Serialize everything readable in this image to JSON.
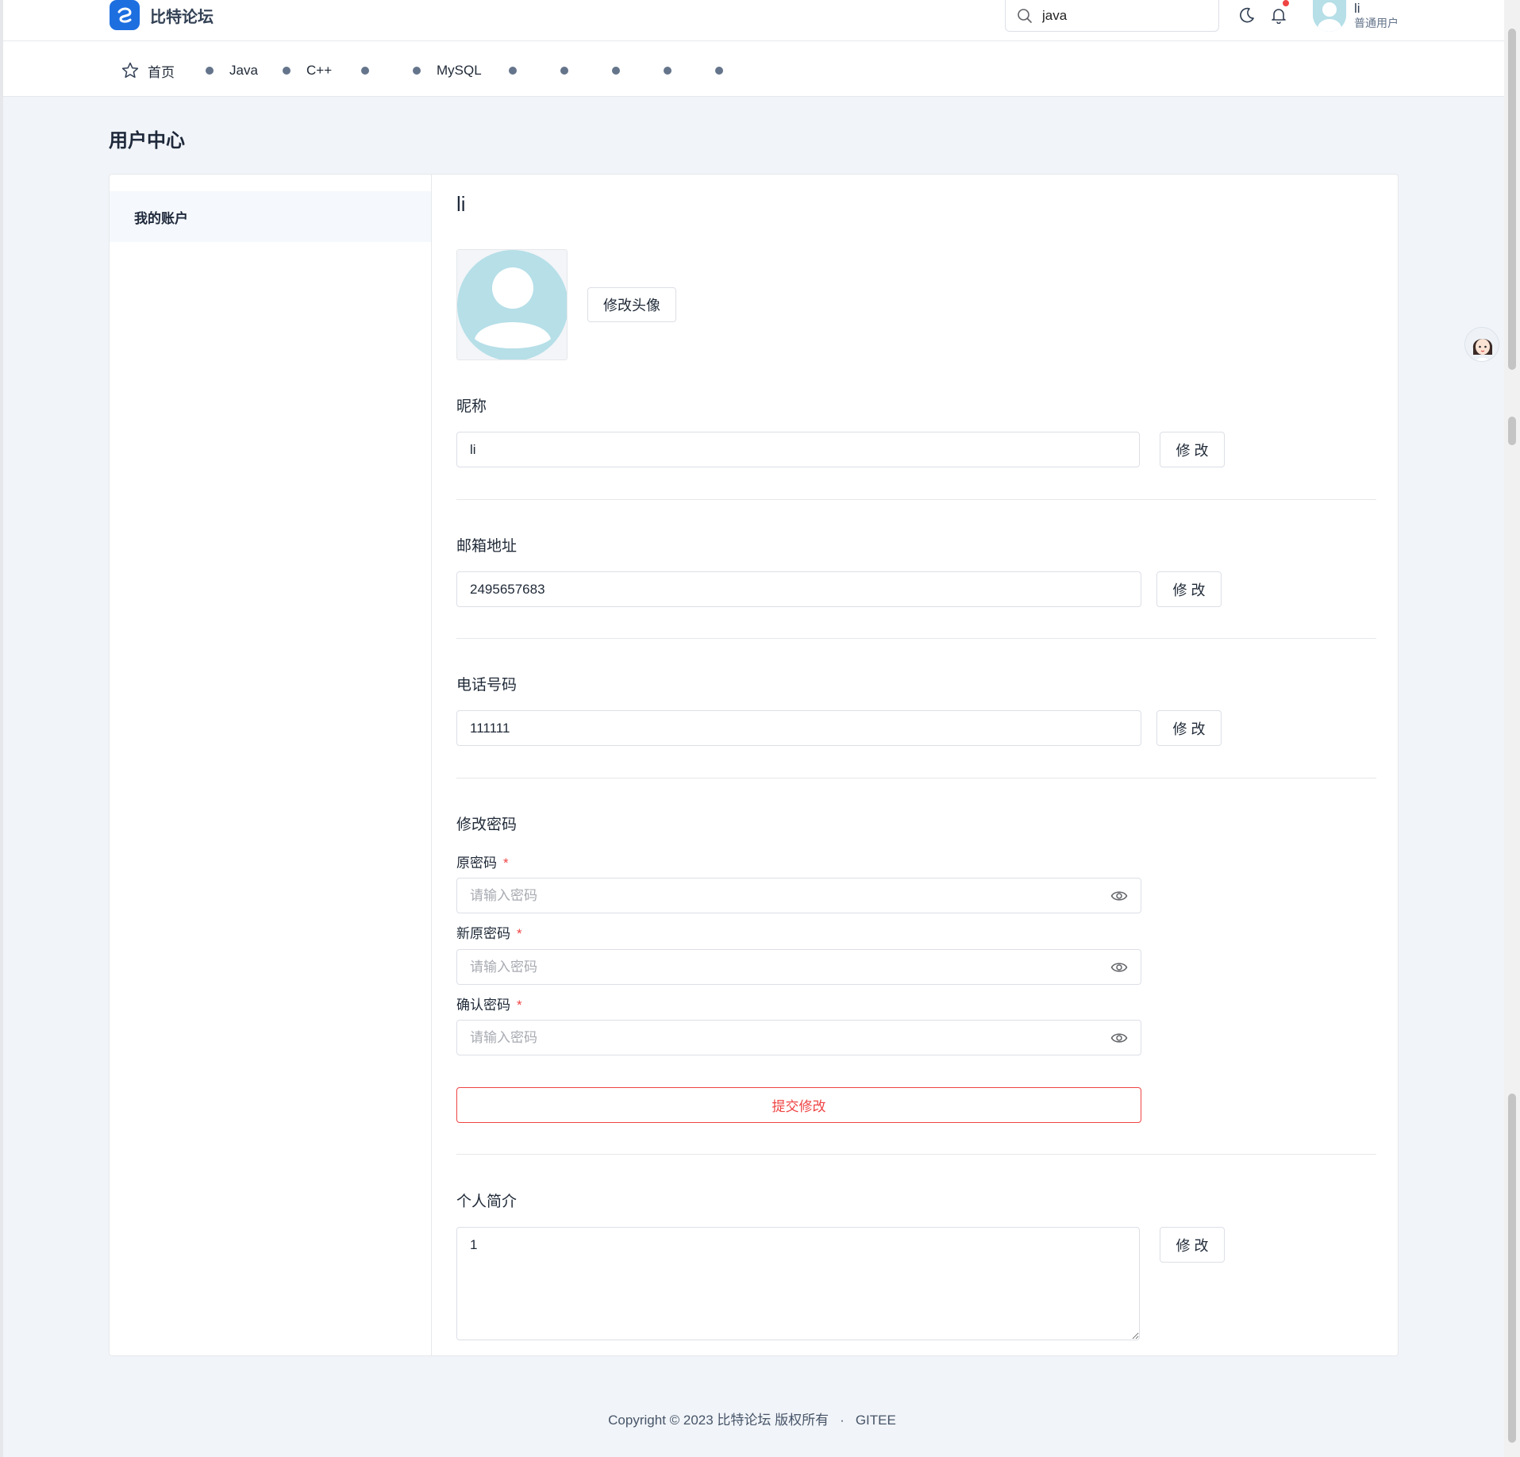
{
  "header": {
    "brand": "比特论坛",
    "search_value": "java",
    "user_name": "li",
    "user_role": "普通用户"
  },
  "nav": {
    "items": [
      {
        "label": "首页",
        "icon": "star-icon"
      },
      {
        "label": "Java",
        "icon": "dot"
      },
      {
        "label": "C++",
        "icon": "dot"
      },
      {
        "label": "",
        "icon": "dot"
      },
      {
        "label": "MySQL",
        "icon": "dot"
      },
      {
        "label": "",
        "icon": "dot"
      },
      {
        "label": "",
        "icon": "dot"
      },
      {
        "label": "",
        "icon": "dot"
      },
      {
        "label": "",
        "icon": "dot"
      },
      {
        "label": "",
        "icon": "dot"
      }
    ]
  },
  "page": {
    "title": "用户中心"
  },
  "sidebar": {
    "items": [
      {
        "label": "我的账户",
        "active": true
      }
    ]
  },
  "profile": {
    "username": "li",
    "change_avatar_label": "修改头像",
    "nickname_label": "昵称",
    "nickname_value": "li",
    "email_label": "邮箱地址",
    "email_value": "2495657683",
    "phone_label": "电话号码",
    "phone_value": "111111",
    "modify_label": "修 改",
    "password_section_label": "修改密码",
    "old_password_label": "原密码",
    "new_password_label": "新原密码",
    "confirm_password_label": "确认密码",
    "required_mark": "*",
    "password_placeholder": "请输入密码",
    "submit_label": "提交修改",
    "bio_label": "个人简介",
    "bio_value": "1"
  },
  "footer": {
    "copyright": "Copyright © 2023 比特论坛 版权所有",
    "separator": "·",
    "link": "GITEE"
  },
  "colors": {
    "brand": "#1d6fe0",
    "danger": "#ef4444",
    "background": "#f1f4f8",
    "avatar": "#b6dfe8"
  }
}
